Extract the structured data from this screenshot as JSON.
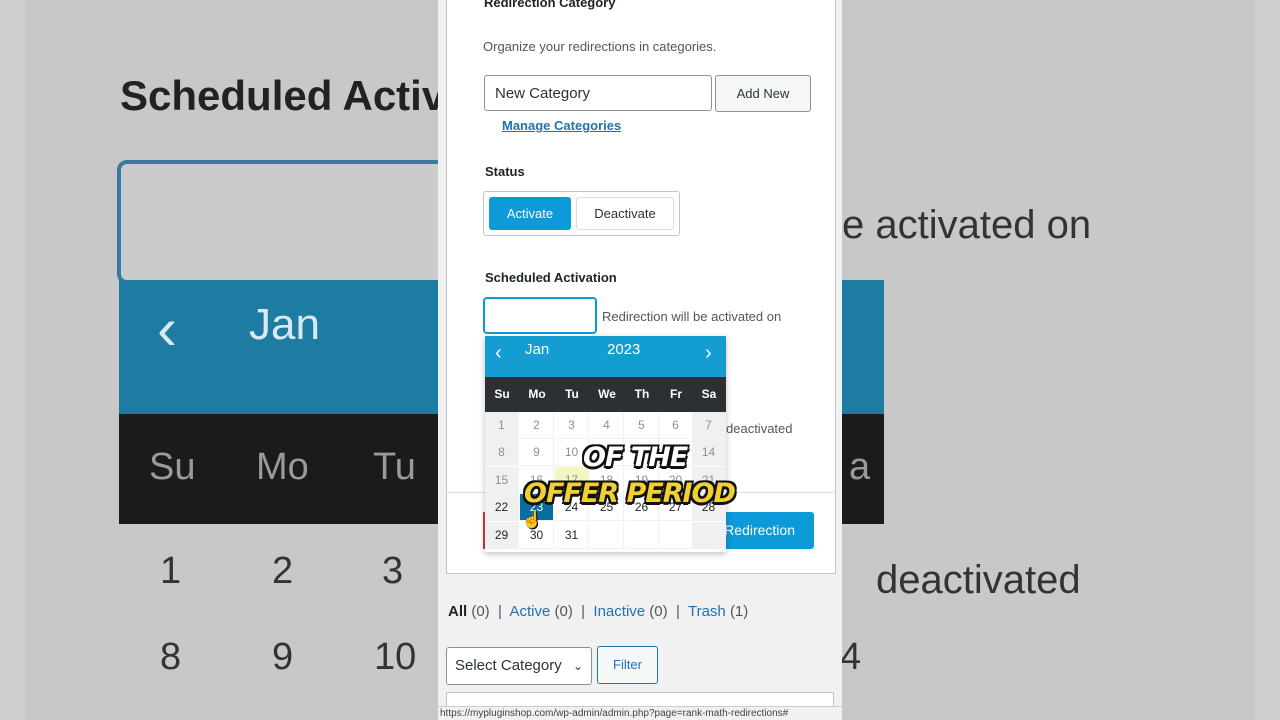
{
  "background": {
    "title": "Scheduled Activ",
    "month": "Jan",
    "days": [
      "Su",
      "Mo",
      "Tu",
      "a"
    ],
    "dates": [
      "1",
      "2",
      "3",
      "8",
      "9",
      "10",
      "4"
    ],
    "text_activated": "e activated on",
    "text_deactivated": "deactivated"
  },
  "category": {
    "label": "Redirection Category",
    "description": "Organize your redirections in categories.",
    "input_value": "New Category",
    "add_new": "Add New",
    "manage": "Manage Categories"
  },
  "status": {
    "label": "Status",
    "activate": "Activate",
    "deactivate": "Deactivate"
  },
  "scheduled": {
    "label": "Scheduled Activation",
    "activated_text": "Redirection will be activated on",
    "deactivated_text": "deactivated"
  },
  "datepicker": {
    "month": "Jan",
    "year": "2023",
    "prev": "‹",
    "next": "›",
    "weekdays": [
      "Su",
      "Mo",
      "Tu",
      "We",
      "Th",
      "Fr",
      "Sa"
    ],
    "rows": [
      [
        "1",
        "2",
        "3",
        "4",
        "5",
        "6",
        "7"
      ],
      [
        "8",
        "9",
        "10",
        "",
        "",
        "",
        "14"
      ],
      [
        "15",
        "16",
        "17",
        "18",
        "19",
        "20",
        "21"
      ],
      [
        "22",
        "23",
        "24",
        "25",
        "26",
        "27",
        "28"
      ],
      [
        "29",
        "30",
        "31",
        "",
        "",
        "",
        ""
      ]
    ],
    "selected": "23",
    "today": "17"
  },
  "save_button": "Redirection",
  "captions": {
    "line1": "OF THE",
    "line2": "OFFER PERIOD"
  },
  "filters": {
    "all": "All",
    "all_count": "(0)",
    "active": "Active",
    "active_count": "(0)",
    "inactive": "Inactive",
    "inactive_count": "(0)",
    "trash": "Trash",
    "trash_count": "(1)",
    "sep": "|"
  },
  "select_category": "Select Category",
  "filter_button": "Filter",
  "status_url": "https://mypluginshop.com/wp-admin/admin.php?page=rank-math-redirections#"
}
